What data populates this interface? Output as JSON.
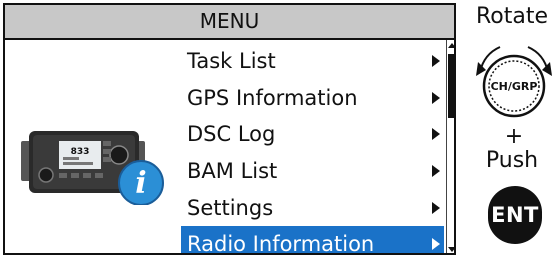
{
  "menu": {
    "title": "MENU",
    "items": [
      {
        "label": "Task List",
        "selected": false
      },
      {
        "label": "GPS Information",
        "selected": false
      },
      {
        "label": "DSC Log",
        "selected": false
      },
      {
        "label": "BAM List",
        "selected": false
      },
      {
        "label": "Settings",
        "selected": false
      },
      {
        "label": "Radio Information",
        "selected": true
      }
    ],
    "selection_color": "#1a72c8"
  },
  "device": {
    "channel_display": "833",
    "info_icon": "i"
  },
  "controls": {
    "rotate_label": "Rotate",
    "knob_label": "CH/GRP",
    "plus_label": "+",
    "push_label": "Push",
    "ent_label": "ENT"
  }
}
